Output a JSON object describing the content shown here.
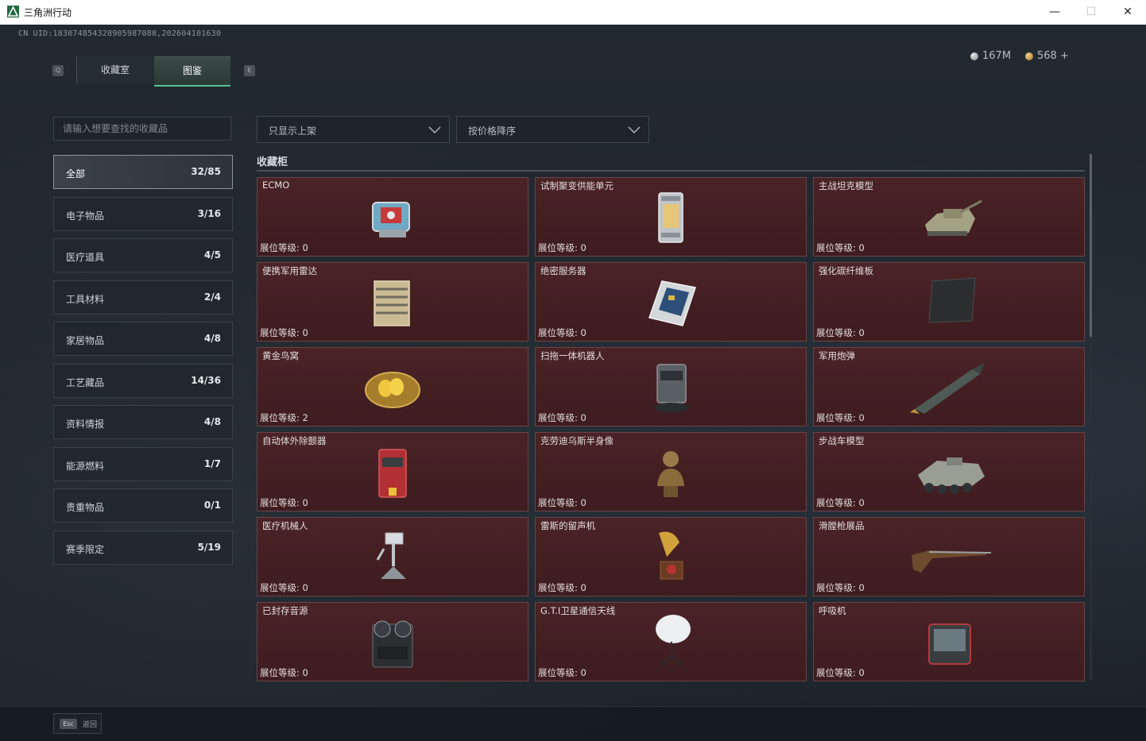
{
  "window": {
    "title": "三角洲行动",
    "min": "—",
    "max": "☐",
    "close": "✕"
  },
  "uid": "CN UID:183074854328905987088,202604101630",
  "currency": {
    "silver": "167M",
    "gold": "568 +"
  },
  "tabs": {
    "left_key": "Q",
    "right_key": "E",
    "items": [
      {
        "label": "收藏室"
      },
      {
        "label": "图鉴",
        "active": true
      }
    ]
  },
  "search": {
    "placeholder": "请输入想要查找的收藏品"
  },
  "categories": [
    {
      "label": "全部",
      "count": "32/85",
      "active": true
    },
    {
      "label": "电子物品",
      "count": "3/16"
    },
    {
      "label": "医疗道具",
      "count": "4/5"
    },
    {
      "label": "工具材料",
      "count": "2/4"
    },
    {
      "label": "家居物品",
      "count": "4/8"
    },
    {
      "label": "工艺藏品",
      "count": "14/36"
    },
    {
      "label": "资料情报",
      "count": "4/8"
    },
    {
      "label": "能源燃料",
      "count": "1/7"
    },
    {
      "label": "贵重物品",
      "count": "0/1"
    },
    {
      "label": "赛季限定",
      "count": "5/19"
    }
  ],
  "filters": {
    "show": "只显示上架",
    "sort": "按价格降序"
  },
  "section_title": "收藏柜",
  "items": [
    {
      "name": "ECMO",
      "level": "展位等级: 0",
      "icon": "ecmo-icon"
    },
    {
      "name": "试制聚变供能单元",
      "level": "展位等级: 0",
      "icon": "fusion-unit-icon"
    },
    {
      "name": "主战坦克模型",
      "level": "展位等级: 0",
      "icon": "tank-model-icon"
    },
    {
      "name": "便携军用雷达",
      "level": "展位等级: 0",
      "icon": "radar-icon"
    },
    {
      "name": "绝密服务器",
      "level": "展位等级: 0",
      "icon": "server-icon"
    },
    {
      "name": "强化碳纤维板",
      "level": "展位等级: 0",
      "icon": "carbon-plate-icon"
    },
    {
      "name": "黄金鸟窝",
      "level": "展位等级: 2",
      "icon": "golden-nest-icon"
    },
    {
      "name": "扫拖一体机器人",
      "level": "展位等级: 0",
      "icon": "robot-vacuum-icon"
    },
    {
      "name": "军用炮弹",
      "level": "展位等级: 0",
      "icon": "artillery-shell-icon"
    },
    {
      "name": "自动体外除颤器",
      "level": "展位等级: 0",
      "icon": "defibrillator-icon"
    },
    {
      "name": "克劳迪乌斯半身像",
      "level": "展位等级: 0",
      "icon": "bust-icon"
    },
    {
      "name": "步战车模型",
      "level": "展位等级: 0",
      "icon": "ifv-model-icon"
    },
    {
      "name": "医疗机械人",
      "level": "展位等级: 0",
      "icon": "medical-robot-icon"
    },
    {
      "name": "雷斯的留声机",
      "level": "展位等级: 0",
      "icon": "gramophone-icon"
    },
    {
      "name": "滑膛枪展品",
      "level": "展位等级: 0",
      "icon": "musket-icon"
    },
    {
      "name": "已封存音源",
      "level": "展位等级: 0",
      "icon": "tape-recorder-icon"
    },
    {
      "name": "G.T.I卫星通信天线",
      "level": "展位等级: 0",
      "icon": "satellite-dish-icon"
    },
    {
      "name": "呼吸机",
      "level": "展位等级: 0",
      "icon": "ventilator-icon"
    }
  ],
  "footer": {
    "esc_key": "Esc",
    "esc_label": "返回"
  }
}
